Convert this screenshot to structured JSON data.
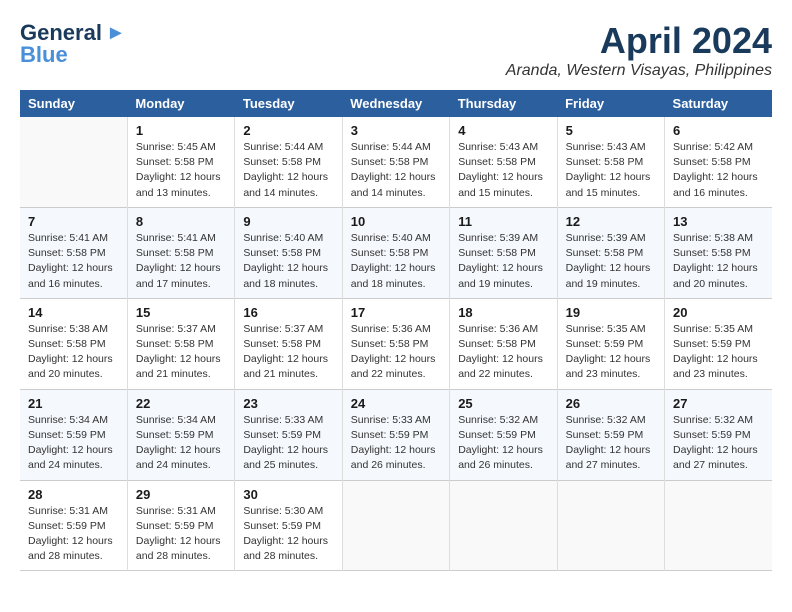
{
  "logo": {
    "line1": "General",
    "line2": "Blue"
  },
  "title": "April 2024",
  "subtitle": "Aranda, Western Visayas, Philippines",
  "days_header": [
    "Sunday",
    "Monday",
    "Tuesday",
    "Wednesday",
    "Thursday",
    "Friday",
    "Saturday"
  ],
  "weeks": [
    [
      {
        "day": "",
        "info": ""
      },
      {
        "day": "1",
        "info": "Sunrise: 5:45 AM\nSunset: 5:58 PM\nDaylight: 12 hours\nand 13 minutes."
      },
      {
        "day": "2",
        "info": "Sunrise: 5:44 AM\nSunset: 5:58 PM\nDaylight: 12 hours\nand 14 minutes."
      },
      {
        "day": "3",
        "info": "Sunrise: 5:44 AM\nSunset: 5:58 PM\nDaylight: 12 hours\nand 14 minutes."
      },
      {
        "day": "4",
        "info": "Sunrise: 5:43 AM\nSunset: 5:58 PM\nDaylight: 12 hours\nand 15 minutes."
      },
      {
        "day": "5",
        "info": "Sunrise: 5:43 AM\nSunset: 5:58 PM\nDaylight: 12 hours\nand 15 minutes."
      },
      {
        "day": "6",
        "info": "Sunrise: 5:42 AM\nSunset: 5:58 PM\nDaylight: 12 hours\nand 16 minutes."
      }
    ],
    [
      {
        "day": "7",
        "info": "Sunrise: 5:41 AM\nSunset: 5:58 PM\nDaylight: 12 hours\nand 16 minutes."
      },
      {
        "day": "8",
        "info": "Sunrise: 5:41 AM\nSunset: 5:58 PM\nDaylight: 12 hours\nand 17 minutes."
      },
      {
        "day": "9",
        "info": "Sunrise: 5:40 AM\nSunset: 5:58 PM\nDaylight: 12 hours\nand 18 minutes."
      },
      {
        "day": "10",
        "info": "Sunrise: 5:40 AM\nSunset: 5:58 PM\nDaylight: 12 hours\nand 18 minutes."
      },
      {
        "day": "11",
        "info": "Sunrise: 5:39 AM\nSunset: 5:58 PM\nDaylight: 12 hours\nand 19 minutes."
      },
      {
        "day": "12",
        "info": "Sunrise: 5:39 AM\nSunset: 5:58 PM\nDaylight: 12 hours\nand 19 minutes."
      },
      {
        "day": "13",
        "info": "Sunrise: 5:38 AM\nSunset: 5:58 PM\nDaylight: 12 hours\nand 20 minutes."
      }
    ],
    [
      {
        "day": "14",
        "info": "Sunrise: 5:38 AM\nSunset: 5:58 PM\nDaylight: 12 hours\nand 20 minutes."
      },
      {
        "day": "15",
        "info": "Sunrise: 5:37 AM\nSunset: 5:58 PM\nDaylight: 12 hours\nand 21 minutes."
      },
      {
        "day": "16",
        "info": "Sunrise: 5:37 AM\nSunset: 5:58 PM\nDaylight: 12 hours\nand 21 minutes."
      },
      {
        "day": "17",
        "info": "Sunrise: 5:36 AM\nSunset: 5:58 PM\nDaylight: 12 hours\nand 22 minutes."
      },
      {
        "day": "18",
        "info": "Sunrise: 5:36 AM\nSunset: 5:58 PM\nDaylight: 12 hours\nand 22 minutes."
      },
      {
        "day": "19",
        "info": "Sunrise: 5:35 AM\nSunset: 5:59 PM\nDaylight: 12 hours\nand 23 minutes."
      },
      {
        "day": "20",
        "info": "Sunrise: 5:35 AM\nSunset: 5:59 PM\nDaylight: 12 hours\nand 23 minutes."
      }
    ],
    [
      {
        "day": "21",
        "info": "Sunrise: 5:34 AM\nSunset: 5:59 PM\nDaylight: 12 hours\nand 24 minutes."
      },
      {
        "day": "22",
        "info": "Sunrise: 5:34 AM\nSunset: 5:59 PM\nDaylight: 12 hours\nand 24 minutes."
      },
      {
        "day": "23",
        "info": "Sunrise: 5:33 AM\nSunset: 5:59 PM\nDaylight: 12 hours\nand 25 minutes."
      },
      {
        "day": "24",
        "info": "Sunrise: 5:33 AM\nSunset: 5:59 PM\nDaylight: 12 hours\nand 26 minutes."
      },
      {
        "day": "25",
        "info": "Sunrise: 5:32 AM\nSunset: 5:59 PM\nDaylight: 12 hours\nand 26 minutes."
      },
      {
        "day": "26",
        "info": "Sunrise: 5:32 AM\nSunset: 5:59 PM\nDaylight: 12 hours\nand 27 minutes."
      },
      {
        "day": "27",
        "info": "Sunrise: 5:32 AM\nSunset: 5:59 PM\nDaylight: 12 hours\nand 27 minutes."
      }
    ],
    [
      {
        "day": "28",
        "info": "Sunrise: 5:31 AM\nSunset: 5:59 PM\nDaylight: 12 hours\nand 28 minutes."
      },
      {
        "day": "29",
        "info": "Sunrise: 5:31 AM\nSunset: 5:59 PM\nDaylight: 12 hours\nand 28 minutes."
      },
      {
        "day": "30",
        "info": "Sunrise: 5:30 AM\nSunset: 5:59 PM\nDaylight: 12 hours\nand 28 minutes."
      },
      {
        "day": "",
        "info": ""
      },
      {
        "day": "",
        "info": ""
      },
      {
        "day": "",
        "info": ""
      },
      {
        "day": "",
        "info": ""
      }
    ]
  ]
}
